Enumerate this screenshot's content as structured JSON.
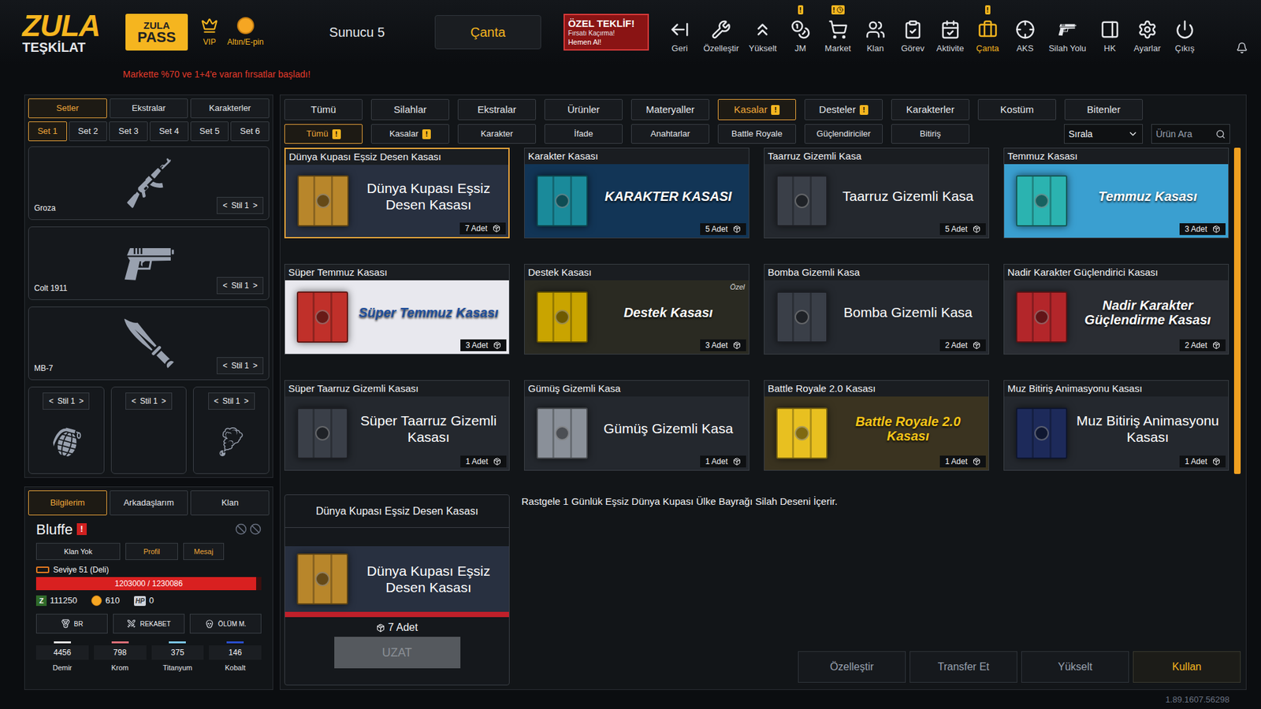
{
  "top_bar": {
    "logo": {
      "line1": "ZULA",
      "line2": "TEŞKİLAT"
    },
    "pass_button": {
      "line1": "ZULA",
      "line2": "PASS"
    },
    "links": [
      {
        "label": "VIP"
      },
      {
        "label": "Altın/E-pin"
      }
    ],
    "server": "Sunucu 5",
    "center_button": "Çanta",
    "offer": {
      "title": "ÖZEL TEKLİF!",
      "subtitle": "Fırsatı Kaçırma!",
      "action": "Hemen Al!"
    },
    "nav": [
      {
        "label": "Geri",
        "selected": false,
        "badge": "",
        "timer": false
      },
      {
        "label": "Özelleştir",
        "selected": false,
        "badge": "",
        "timer": false
      },
      {
        "label": "Yükselt",
        "selected": false,
        "badge": "",
        "timer": false
      },
      {
        "label": "JM",
        "selected": false,
        "badge": "!",
        "timer": false
      },
      {
        "label": "Market",
        "selected": false,
        "badge": "!",
        "timer": true
      },
      {
        "label": "Klan",
        "selected": false,
        "badge": "",
        "timer": false
      },
      {
        "label": "Görev",
        "selected": false,
        "badge": "",
        "timer": false
      },
      {
        "label": "Aktivite",
        "selected": false,
        "badge": "",
        "timer": false
      },
      {
        "label": "Çanta",
        "selected": true,
        "badge": "!",
        "timer": false
      },
      {
        "label": "AKS",
        "selected": false,
        "badge": "",
        "timer": false
      },
      {
        "label": "Silah Yolu",
        "selected": false,
        "badge": "",
        "timer": false
      },
      {
        "label": "HK",
        "selected": false,
        "badge": "",
        "timer": false
      },
      {
        "label": "Ayarlar",
        "selected": false,
        "badge": "",
        "timer": false
      },
      {
        "label": "Çıkış",
        "selected": false,
        "badge": "",
        "timer": false
      }
    ]
  },
  "announcement": "Markette %70 ve 1+4'e varan fırsatlar başladı!",
  "left_panel": {
    "tabs": [
      {
        "label": "Setler",
        "selected": true
      },
      {
        "label": "Ekstralar",
        "selected": false
      },
      {
        "label": "Karakterler",
        "selected": false
      }
    ],
    "sets": [
      {
        "label": "Set 1",
        "selected": true
      },
      {
        "label": "Set 2",
        "selected": false
      },
      {
        "label": "Set 3",
        "selected": false
      },
      {
        "label": "Set 4",
        "selected": false
      },
      {
        "label": "Set 5",
        "selected": false
      },
      {
        "label": "Set 6",
        "selected": false
      }
    ],
    "arrows": {
      "prev": "<",
      "next": ">"
    },
    "slots": [
      {
        "name": "Groza",
        "style": "Stil 1"
      },
      {
        "name": "Colt 1911",
        "style": "Stil 1"
      },
      {
        "name": "MB-7",
        "style": "Stil 1"
      }
    ],
    "small_slots": [
      {
        "style": "Stil 1",
        "empty": false
      },
      {
        "style": "Stil 1",
        "empty": true
      },
      {
        "style": "Stil 1",
        "empty": false
      }
    ]
  },
  "profile": {
    "tabs": [
      {
        "label": "Bilgilerim",
        "selected": true
      },
      {
        "label": "Arkadaşlarım",
        "selected": false
      },
      {
        "label": "Klan",
        "selected": false
      }
    ],
    "name": "Bluffe",
    "alert": "!",
    "buttons": [
      {
        "label": "Klan Yok",
        "accent": false
      },
      {
        "label": "Profil",
        "accent": true
      },
      {
        "label": "Mesaj",
        "accent": true
      }
    ],
    "level_label": "Seviye 51 (Deli)",
    "xp": {
      "reading": "1203000 / 1230086",
      "level": 0.978
    },
    "currencies": [
      {
        "kind": "badge",
        "symbol": "Z",
        "value": "111250"
      },
      {
        "kind": "coin",
        "symbol": "",
        "value": "610"
      },
      {
        "kind": "tag",
        "symbol": "HP",
        "value": "0"
      }
    ],
    "modes": [
      "BR",
      "REKABET",
      "ÖLÜM M."
    ],
    "resources": [
      {
        "name": "Demir",
        "value": "4456",
        "color": "#e6e6e6"
      },
      {
        "name": "Krom",
        "value": "798",
        "color": "#e0707a"
      },
      {
        "name": "Titanyum",
        "value": "375",
        "color": "#7cc8e8"
      },
      {
        "name": "Kobalt",
        "value": "146",
        "color": "#2a4fd0"
      }
    ]
  },
  "category_tabs": [
    {
      "label": "Tümü",
      "selected": false,
      "alert": ""
    },
    {
      "label": "Silahlar",
      "selected": false,
      "alert": ""
    },
    {
      "label": "Ekstralar",
      "selected": false,
      "alert": ""
    },
    {
      "label": "Ürünler",
      "selected": false,
      "alert": ""
    },
    {
      "label": "Materyaller",
      "selected": false,
      "alert": ""
    },
    {
      "label": "Kasalar",
      "selected": true,
      "alert": "!"
    },
    {
      "label": "Desteler",
      "selected": false,
      "alert": "!"
    },
    {
      "label": "Karakterler",
      "selected": false,
      "alert": ""
    },
    {
      "label": "Kostüm",
      "selected": false,
      "alert": ""
    },
    {
      "label": "Bitenler",
      "selected": false,
      "alert": ""
    }
  ],
  "sub_tabs": [
    {
      "label": "Tümü",
      "selected": true,
      "alert": "!"
    },
    {
      "label": "Kasalar",
      "selected": false,
      "alert": "!"
    },
    {
      "label": "Karakter",
      "selected": false,
      "alert": ""
    },
    {
      "label": "İfade",
      "selected": false,
      "alert": ""
    },
    {
      "label": "Anahtarlar",
      "selected": false,
      "alert": ""
    },
    {
      "label": "Battle Royale",
      "selected": false,
      "alert": ""
    },
    {
      "label": "Güçlendiriciler",
      "selected": false,
      "alert": ""
    },
    {
      "label": "Bitiriş",
      "selected": false,
      "alert": ""
    }
  ],
  "sort": {
    "label": "Sırala"
  },
  "search": {
    "placeholder": "Ürün Ara"
  },
  "cards": [
    {
      "title": "Dünya Kupası Eşsiz Desen Kasası",
      "banner": "Dünya Kupası Eşsiz Desen Kasası",
      "count": "7 Adet",
      "selected": true,
      "kind": "plain",
      "color": "#b8862b",
      "bg": "#283040",
      "ink": "#ffffff",
      "tag": ""
    },
    {
      "title": "Karakter Kasası",
      "banner": "KARAKTER KASASI",
      "count": "5 Adet",
      "selected": false,
      "kind": "art",
      "color": "#1a8a9a",
      "bg": "#123556",
      "ink": "#ffffff",
      "tag": ""
    },
    {
      "title": "Taarruz Gizemli Kasa",
      "banner": "Taarruz Gizemli Kasa",
      "count": "5 Adet",
      "selected": false,
      "kind": "plain",
      "color": "#3a3f48",
      "bg": "#24282e",
      "ink": "#ffffff",
      "tag": ""
    },
    {
      "title": "Temmuz Kasası",
      "banner": "Temmuz Kasası",
      "count": "3 Adet",
      "selected": false,
      "kind": "art",
      "color": "#2bb3b0",
      "bg": "#3a9fd0",
      "ink": "#ffffff",
      "tag": ""
    },
    {
      "title": "Süper Temmuz Kasası",
      "banner": "Süper Temmuz Kasası",
      "count": "3 Adet",
      "selected": false,
      "kind": "art",
      "color": "#c0302a",
      "bg": "#e8e8ee",
      "ink": "#1f4e9a",
      "tag": ""
    },
    {
      "title": "Destek Kasası",
      "banner": "Destek Kasası",
      "count": "3 Adet",
      "selected": false,
      "kind": "art",
      "color": "#c9a400",
      "bg": "#2a2a22",
      "ink": "#ffffff",
      "tag": "Özel"
    },
    {
      "title": "Bomba Gizemli Kasa",
      "banner": "Bomba Gizemli Kasa",
      "count": "2 Adet",
      "selected": false,
      "kind": "plain",
      "color": "#3a3f48",
      "bg": "#24282e",
      "ink": "#ffffff",
      "tag": ""
    },
    {
      "title": "Nadir Karakter Güçlendirici Kasası",
      "banner": "Nadir Karakter Güçlendirme Kasası",
      "count": "2 Adet",
      "selected": false,
      "kind": "art",
      "color": "#b3262a",
      "bg": "#2a2d33",
      "ink": "#ffffff",
      "tag": ""
    },
    {
      "title": "Süper Taarruz Gizemli Kasası",
      "banner": "Süper Taarruz Gizemli Kasası",
      "count": "1 Adet",
      "selected": false,
      "kind": "plain",
      "color": "#3a3f48",
      "bg": "#24282e",
      "ink": "#ffffff",
      "tag": ""
    },
    {
      "title": "Gümüş Gizemli Kasa",
      "banner": "Gümüş Gizemli Kasa",
      "count": "1 Adet",
      "selected": false,
      "kind": "plain",
      "color": "#8a9099",
      "bg": "#24282e",
      "ink": "#ffffff",
      "tag": ""
    },
    {
      "title": "Battle Royale 2.0 Kasası",
      "banner": "Battle Royale 2.0 Kasası",
      "count": "1 Adet",
      "selected": false,
      "kind": "art",
      "color": "#e8c020",
      "bg": "#3a3320",
      "ink": "#f5c518",
      "tag": ""
    },
    {
      "title": "Muz Bitiriş Animasyonu Kasası",
      "banner": "Muz Bitiriş Animasyonu Kasası",
      "count": "1 Adet",
      "selected": false,
      "kind": "plain",
      "color": "#1d2a5a",
      "bg": "#24282e",
      "ink": "#ffffff",
      "tag": ""
    }
  ],
  "detail": {
    "title": "Dünya Kupası Eşsiz Desen Kasası",
    "banner": "Dünya Kupası Eşsiz Desen Kasası",
    "count": "7 Adet",
    "color": "#b8862b",
    "bg": "#283040",
    "extend_button": {
      "label": "UZAT",
      "disabled": true
    },
    "description": "Rastgele 1 Günlük Eşsiz Dünya Kupası Ülke Bayrağı Silah Deseni İçerir."
  },
  "actions": [
    {
      "label": "Özelleştir",
      "primary": false
    },
    {
      "label": "Transfer Et",
      "primary": false
    },
    {
      "label": "Yükselt",
      "primary": false
    },
    {
      "label": "Kullan",
      "primary": true
    }
  ],
  "version": "1.89.1607.56298"
}
